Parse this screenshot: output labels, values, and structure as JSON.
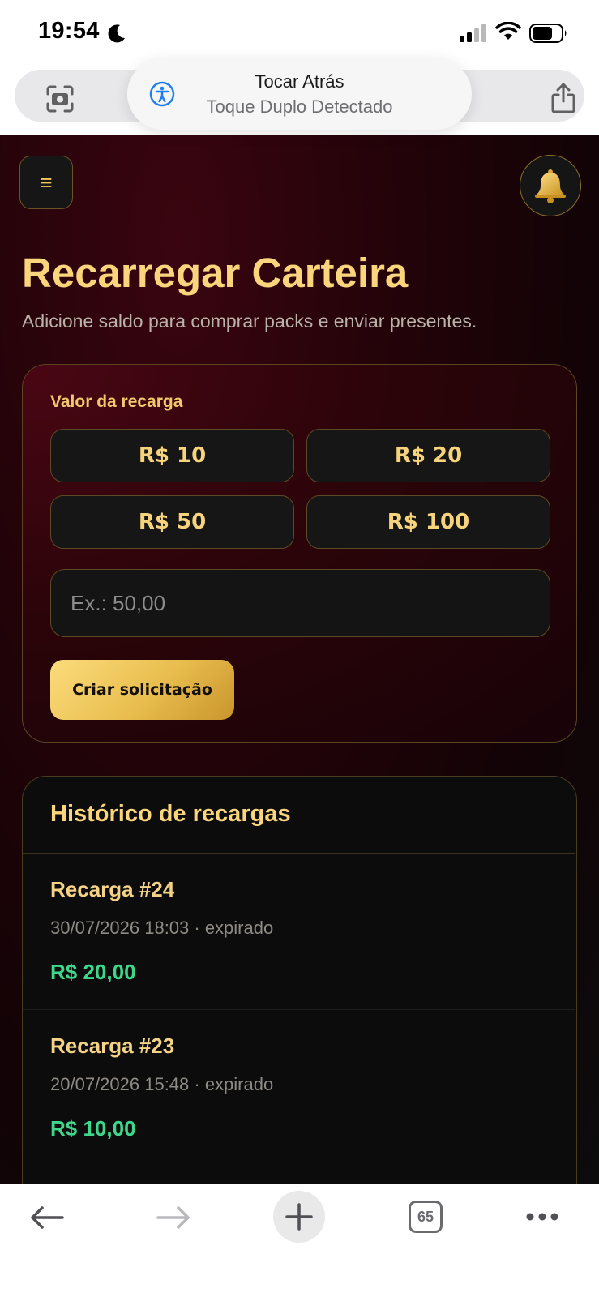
{
  "status_bar": {
    "time": "19:54"
  },
  "accessibility_banner": {
    "title": "Tocar Atrás",
    "subtitle": "Toque Duplo Detectado"
  },
  "header": {
    "menu_icon_glyph": "≡",
    "bell_icon_glyph": "🔔"
  },
  "page": {
    "title": "Recarregar Carteira",
    "subtitle": "Adicione saldo para comprar packs e enviar presentes."
  },
  "recharge": {
    "label": "Valor da recarga",
    "amounts": [
      "R$ 10",
      "R$ 20",
      "R$ 50",
      "R$ 100"
    ],
    "input_placeholder": "Ex.: 50,00",
    "input_value": "",
    "submit_label": "Criar solicitação"
  },
  "history": {
    "title": "Histórico de recargas",
    "items": [
      {
        "title": "Recarga #24",
        "meta": "30/07/2026 18:03 · expirado",
        "amount": "R$ 20,00"
      },
      {
        "title": "Recarga #23",
        "meta": "20/07/2026 15:48 · expirado",
        "amount": "R$ 10,00"
      }
    ]
  },
  "toolbar": {
    "tab_count": "65"
  },
  "colors": {
    "accent_gold": "#fad57c",
    "amount_green": "#3ed78c",
    "background_dark": "#0c0c0c",
    "card_wine": "#2c0409"
  }
}
